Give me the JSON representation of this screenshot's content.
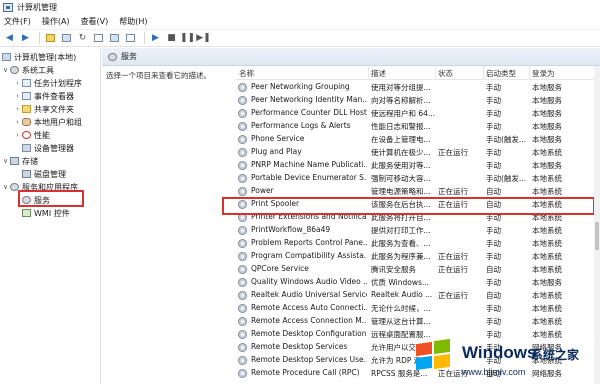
{
  "window": {
    "title": "计算机管理"
  },
  "menu": [
    "文件(F)",
    "操作(A)",
    "查看(V)",
    "帮助(H)"
  ],
  "toolbar_icons": [
    "back-arrow-icon",
    "forward-arrow-icon",
    "up-folder-icon",
    "console-tree-icon",
    "refresh-icon",
    "export-icon",
    "help-icon",
    "properties-icon",
    "play-icon",
    "stop-icon",
    "pause-icon",
    "restart-icon"
  ],
  "tree": {
    "root": "计算机管理(本地)",
    "system_tools": "系统工具",
    "task_scheduler": "任务计划程序",
    "event_viewer": "事件查看器",
    "shared_folders": "共享文件夹",
    "local_users": "本地用户和组",
    "performance": "性能",
    "device_manager": "设备管理器",
    "storage": "存储",
    "disk_management": "磁盘管理",
    "services_apps": "服务和应用程序",
    "services": "服务",
    "wmi": "WMI 控件"
  },
  "panel": {
    "title": "服务",
    "description": "选择一个项目来查看它的描述。"
  },
  "columns": {
    "name": "名称",
    "desc": "描述",
    "status": "状态",
    "startup": "启动类型",
    "logon": "登录为"
  },
  "services": [
    {
      "name": "Peer Networking Grouping",
      "desc": "使用对等分组提...",
      "status": "",
      "startup": "手动",
      "logon": "本地服务"
    },
    {
      "name": "Peer Networking Identity Man...",
      "desc": "向对等名称解析...",
      "status": "",
      "startup": "手动",
      "logon": "本地服务"
    },
    {
      "name": "Performance Counter DLL Host",
      "desc": "使远程用户和 64...",
      "status": "",
      "startup": "手动",
      "logon": "本地服务"
    },
    {
      "name": "Performance Logs & Alerts",
      "desc": "性能日志和警报...",
      "status": "",
      "startup": "手动",
      "logon": "本地服务"
    },
    {
      "name": "Phone Service",
      "desc": "在设备上管理电...",
      "status": "",
      "startup": "手动(触发...",
      "logon": "本地服务"
    },
    {
      "name": "Plug and Play",
      "desc": "使计算机在极少...",
      "status": "正在运行",
      "startup": "手动",
      "logon": "本地系统"
    },
    {
      "name": "PNRP Machine Name Publicati...",
      "desc": "此服务使用对等...",
      "status": "",
      "startup": "手动",
      "logon": "本地服务"
    },
    {
      "name": "Portable Device Enumerator S...",
      "desc": "强制可移动大容...",
      "status": "",
      "startup": "手动(触发...",
      "logon": "本地系统"
    },
    {
      "name": "Power",
      "desc": "管理电源策略和...",
      "status": "正在运行",
      "startup": "自动",
      "logon": "本地系统"
    },
    {
      "name": "Print Spooler",
      "desc": "该服务在后台执...",
      "status": "正在运行",
      "startup": "自动",
      "logon": "本地系统"
    },
    {
      "name": "Printer Extensions and Notifica...",
      "desc": "此服务将打开自...",
      "status": "",
      "startup": "手动",
      "logon": "本地系统"
    },
    {
      "name": "PrintWorkflow_86a49",
      "desc": "提供对打印工作...",
      "status": "",
      "startup": "手动",
      "logon": "本地系统"
    },
    {
      "name": "Problem Reports Control Pane...",
      "desc": "此服务为查看、...",
      "status": "",
      "startup": "手动",
      "logon": "本地系统"
    },
    {
      "name": "Program Compatibility Assista...",
      "desc": "此服务为程序兼...",
      "status": "正在运行",
      "startup": "手动",
      "logon": "本地系统"
    },
    {
      "name": "QPCore Service",
      "desc": "腾讯安全服务",
      "status": "正在运行",
      "startup": "自动",
      "logon": "本地系统"
    },
    {
      "name": "Quality Windows Audio Video ...",
      "desc": "优质 Windows...",
      "status": "",
      "startup": "手动",
      "logon": "本地服务"
    },
    {
      "name": "Realtek Audio Universal Service",
      "desc": "Realtek Audio ...",
      "status": "正在运行",
      "startup": "自动",
      "logon": "本地系统"
    },
    {
      "name": "Remote Access Auto Connecti...",
      "desc": "无论什么时候，...",
      "status": "",
      "startup": "手动",
      "logon": "本地系统"
    },
    {
      "name": "Remote Access Connection M...",
      "desc": "管理从这台计算...",
      "status": "",
      "startup": "手动",
      "logon": "本地系统"
    },
    {
      "name": "Remote Desktop Configuration",
      "desc": "远程桌面配置服...",
      "status": "",
      "startup": "手动",
      "logon": "本地系统"
    },
    {
      "name": "Remote Desktop Services",
      "desc": "允许用户以交互...",
      "status": "",
      "startup": "手动",
      "logon": "网络服务"
    },
    {
      "name": "Remote Desktop Services Use...",
      "desc": "允许为 RDP 连...",
      "status": "",
      "startup": "手动",
      "logon": "本地系统"
    },
    {
      "name": "Remote Procedure Call (RPC)",
      "desc": "RPCSS 服务是...",
      "status": "正在运行",
      "startup": "自动",
      "logon": "网络服务"
    }
  ],
  "watermark": {
    "brand": "Windows",
    "suffix": "系统之家",
    "url": "www.bjjmlv.com"
  }
}
